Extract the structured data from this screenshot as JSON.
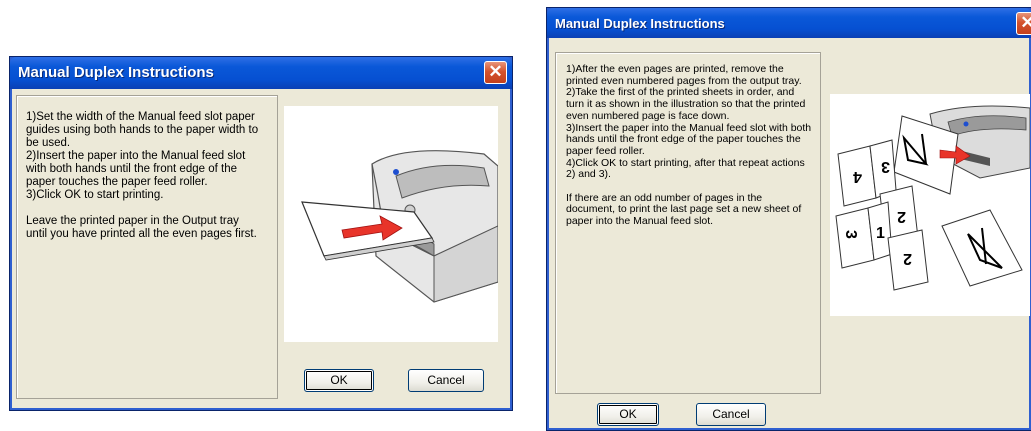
{
  "dialog1": {
    "title": "Manual Duplex Instructions",
    "close_glyph": "✕",
    "instructions": "1)Set the width of the Manual feed slot paper guides using both hands to the paper width to be used.\n2)Insert the paper into the Manual feed slot with both hands until the front edge of the paper touches the paper feed roller.\n3)Click OK to start printing.\n\nLeave the printed paper in the Output tray until you have printed all the even pages first.",
    "ok_label": "OK",
    "cancel_label": "Cancel"
  },
  "dialog2": {
    "title": "Manual Duplex Instructions",
    "close_glyph": "✕",
    "instructions": "1)After the even pages are printed, remove the printed even numbered pages from the output tray.\n2)Take the first of the printed sheets in order, and turn it as shown in the illustration so that the printed even numbered page is face down.\n3)Insert the paper into the Manual feed slot with both hands until the front edge of the paper touches the paper feed roller.\n4)Click OK to start printing, after that repeat actions 2) and 3).\n\n If there are an odd number of pages in the document, to print the last page set a new sheet of paper into the Manual feed slot.",
    "ok_label": "OK",
    "cancel_label": "Cancel"
  },
  "colors": {
    "titlebar": "#0650d2",
    "dialog_face": "#ece9d8",
    "close_button": "#d4532e",
    "arrow_red": "#e8342a"
  },
  "icons": {
    "close": "close-icon",
    "printer": "printer-illustration",
    "pages": "page-flip-illustration"
  }
}
